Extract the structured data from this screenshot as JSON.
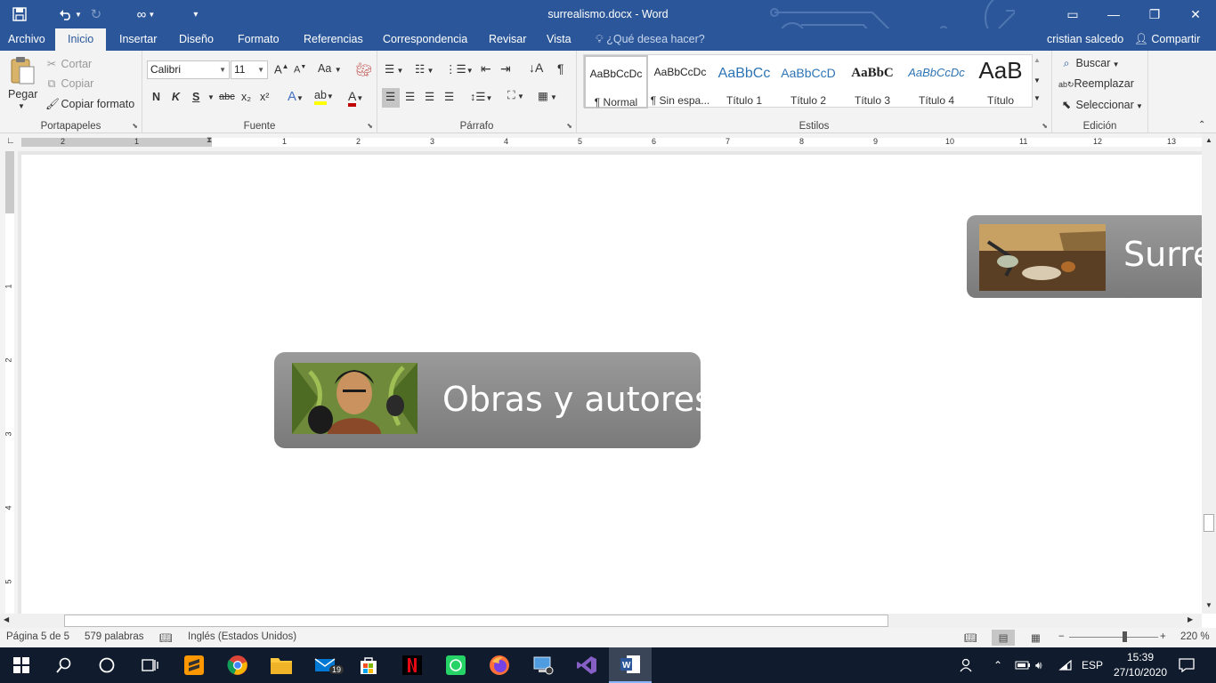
{
  "window": {
    "title": "surrealismo.docx - Word",
    "qat": {
      "redo_icon": "redo-icon"
    }
  },
  "tabs": [
    "Archivo",
    "Inicio",
    "Insertar",
    "Diseño",
    "Formato",
    "Referencias",
    "Correspondencia",
    "Revisar",
    "Vista"
  ],
  "tell_me": "¿Qué desea hacer?",
  "user": "cristian salcedo",
  "share": "Compartir",
  "clipboard": {
    "paste": "Pegar",
    "cut": "Cortar",
    "copy": "Copiar",
    "format_painter": "Copiar formato",
    "label": "Portapapeles"
  },
  "font": {
    "name": "Calibri",
    "size": "11",
    "label": "Fuente",
    "bold": "N",
    "italic": "K",
    "underline": "S",
    "strike": "abc",
    "sub": "x₂",
    "sup": "x²",
    "change_case": "Aa"
  },
  "paragraph": {
    "label": "Párrafo"
  },
  "styles": {
    "label": "Estilos",
    "items": [
      {
        "preview": "AaBbCcDc",
        "name": "¶ Normal"
      },
      {
        "preview": "AaBbCcDc",
        "name": "¶ Sin espa..."
      },
      {
        "preview": "AaBbCc",
        "name": "Título 1"
      },
      {
        "preview": "AaBbCcD",
        "name": "Título 2"
      },
      {
        "preview": "AaBbC",
        "name": "Título 3"
      },
      {
        "preview": "AaBbCcDc",
        "name": "Título 4"
      },
      {
        "preview": "AaB",
        "name": "Título"
      }
    ]
  },
  "editing": {
    "label": "Edición",
    "find": "Buscar",
    "replace": "Reemplazar",
    "select": "Seleccionar"
  },
  "ruler": {
    "h": [
      "2",
      "1",
      "1",
      "2",
      "3",
      "4",
      "5",
      "6",
      "7",
      "8",
      "9",
      "10",
      "11",
      "12",
      "13"
    ],
    "v": [
      "1",
      "2",
      "3",
      "4",
      "5"
    ]
  },
  "document": {
    "card1_text": "Obras y autores",
    "card2_text": "Surre"
  },
  "status": {
    "page": "Página 5 de 5",
    "words": "579 palabras",
    "language": "Inglés (Estados Unidos)",
    "zoom": "220 %"
  },
  "taskbar": {
    "mail_badge": "19",
    "lang": "ESP",
    "time": "15:39",
    "date": "27/10/2020"
  }
}
